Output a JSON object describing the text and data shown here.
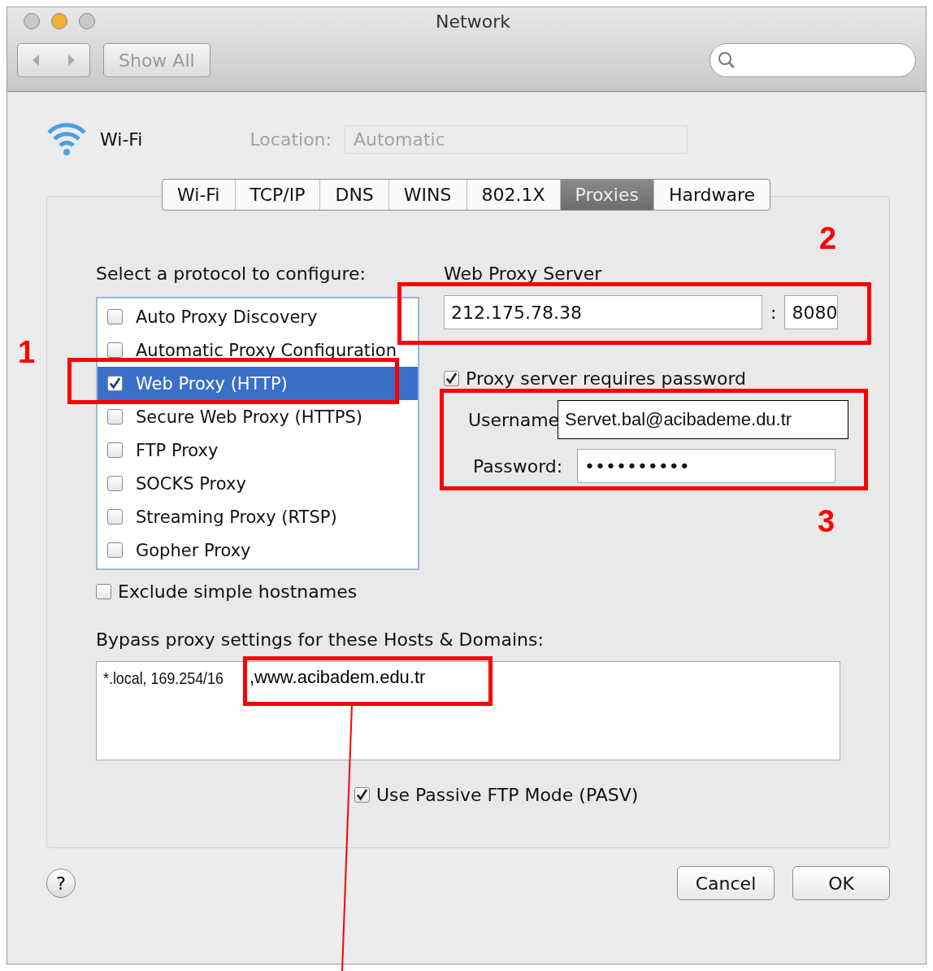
{
  "window": {
    "title": "Network"
  },
  "toolbar": {
    "show_all": "Show All"
  },
  "interface": {
    "name": "Wi-Fi"
  },
  "background": {
    "location_label": "Location:",
    "location_value": "Automatic"
  },
  "tabs": [
    {
      "label": "Wi-Fi",
      "selected": false
    },
    {
      "label": "TCP/IP",
      "selected": false
    },
    {
      "label": "DNS",
      "selected": false
    },
    {
      "label": "WINS",
      "selected": false
    },
    {
      "label": "802.1X",
      "selected": false
    },
    {
      "label": "Proxies",
      "selected": true
    },
    {
      "label": "Hardware",
      "selected": false
    }
  ],
  "protocols": {
    "label": "Select a protocol to configure:",
    "items": [
      {
        "label": "Auto Proxy Discovery",
        "checked": false,
        "selected": false
      },
      {
        "label": "Automatic Proxy Configuration",
        "checked": false,
        "selected": false
      },
      {
        "label": "Web Proxy (HTTP)",
        "checked": true,
        "selected": true
      },
      {
        "label": "Secure Web Proxy (HTTPS)",
        "checked": false,
        "selected": false
      },
      {
        "label": "FTP Proxy",
        "checked": false,
        "selected": false
      },
      {
        "label": "SOCKS Proxy",
        "checked": false,
        "selected": false
      },
      {
        "label": "Streaming Proxy (RTSP)",
        "checked": false,
        "selected": false
      },
      {
        "label": "Gopher Proxy",
        "checked": false,
        "selected": false
      }
    ]
  },
  "server": {
    "label": "Web Proxy Server",
    "host": "212.175.78.38",
    "separator": ":",
    "port": "8080"
  },
  "requires_password": {
    "label": "Proxy server requires password",
    "checked": true
  },
  "username": {
    "label": "Username",
    "value": "Servet.bal@acibademe.du.tr"
  },
  "password": {
    "label": "Password:",
    "value": "••••••••••"
  },
  "exclude_simple": {
    "label": "Exclude simple hostnames",
    "checked": false
  },
  "bypass": {
    "label": "Bypass proxy settings for these Hosts & Domains:",
    "value": "*.local, 169.254/16",
    "added": ",www.acibadem.edu.tr"
  },
  "passive_ftp": {
    "label": "Use Passive FTP Mode (PASV)",
    "checked": true
  },
  "help": "?",
  "buttons": [
    "Cancel",
    "OK"
  ],
  "annotations": [
    {
      "number": "1"
    },
    {
      "number": "2"
    },
    {
      "number": "3"
    }
  ]
}
